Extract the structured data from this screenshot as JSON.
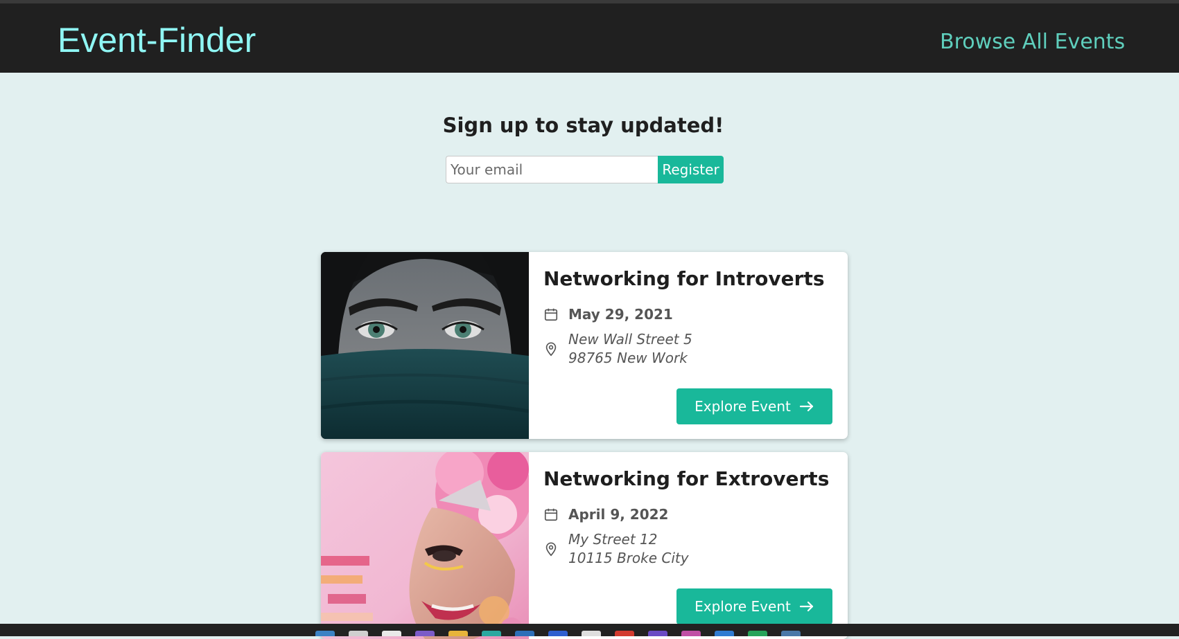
{
  "header": {
    "brand": "Event-Finder",
    "nav_link": "Browse All Events"
  },
  "signup": {
    "title": "Sign up to stay updated!",
    "email_placeholder": "Your email",
    "register_label": "Register"
  },
  "events": [
    {
      "title": "Networking for Introverts",
      "date": "May 29, 2021",
      "address_line1": "New Wall Street 5",
      "address_line2": "98765 New Work",
      "button_label": "Explore Event",
      "image_icon": "woman-covered-face-image"
    },
    {
      "title": "Networking for Extroverts",
      "date": "April 9, 2022",
      "address_line1": "My Street 12",
      "address_line2": "10115 Broke City",
      "button_label": "Explore Event",
      "image_icon": "carnival-performer-image"
    }
  ],
  "colors": {
    "header_bg": "#202020",
    "brand": "#8ff6f4",
    "nav_link": "#5fcfbd",
    "page_bg": "#e2f0f0",
    "accent": "#19b89a"
  }
}
